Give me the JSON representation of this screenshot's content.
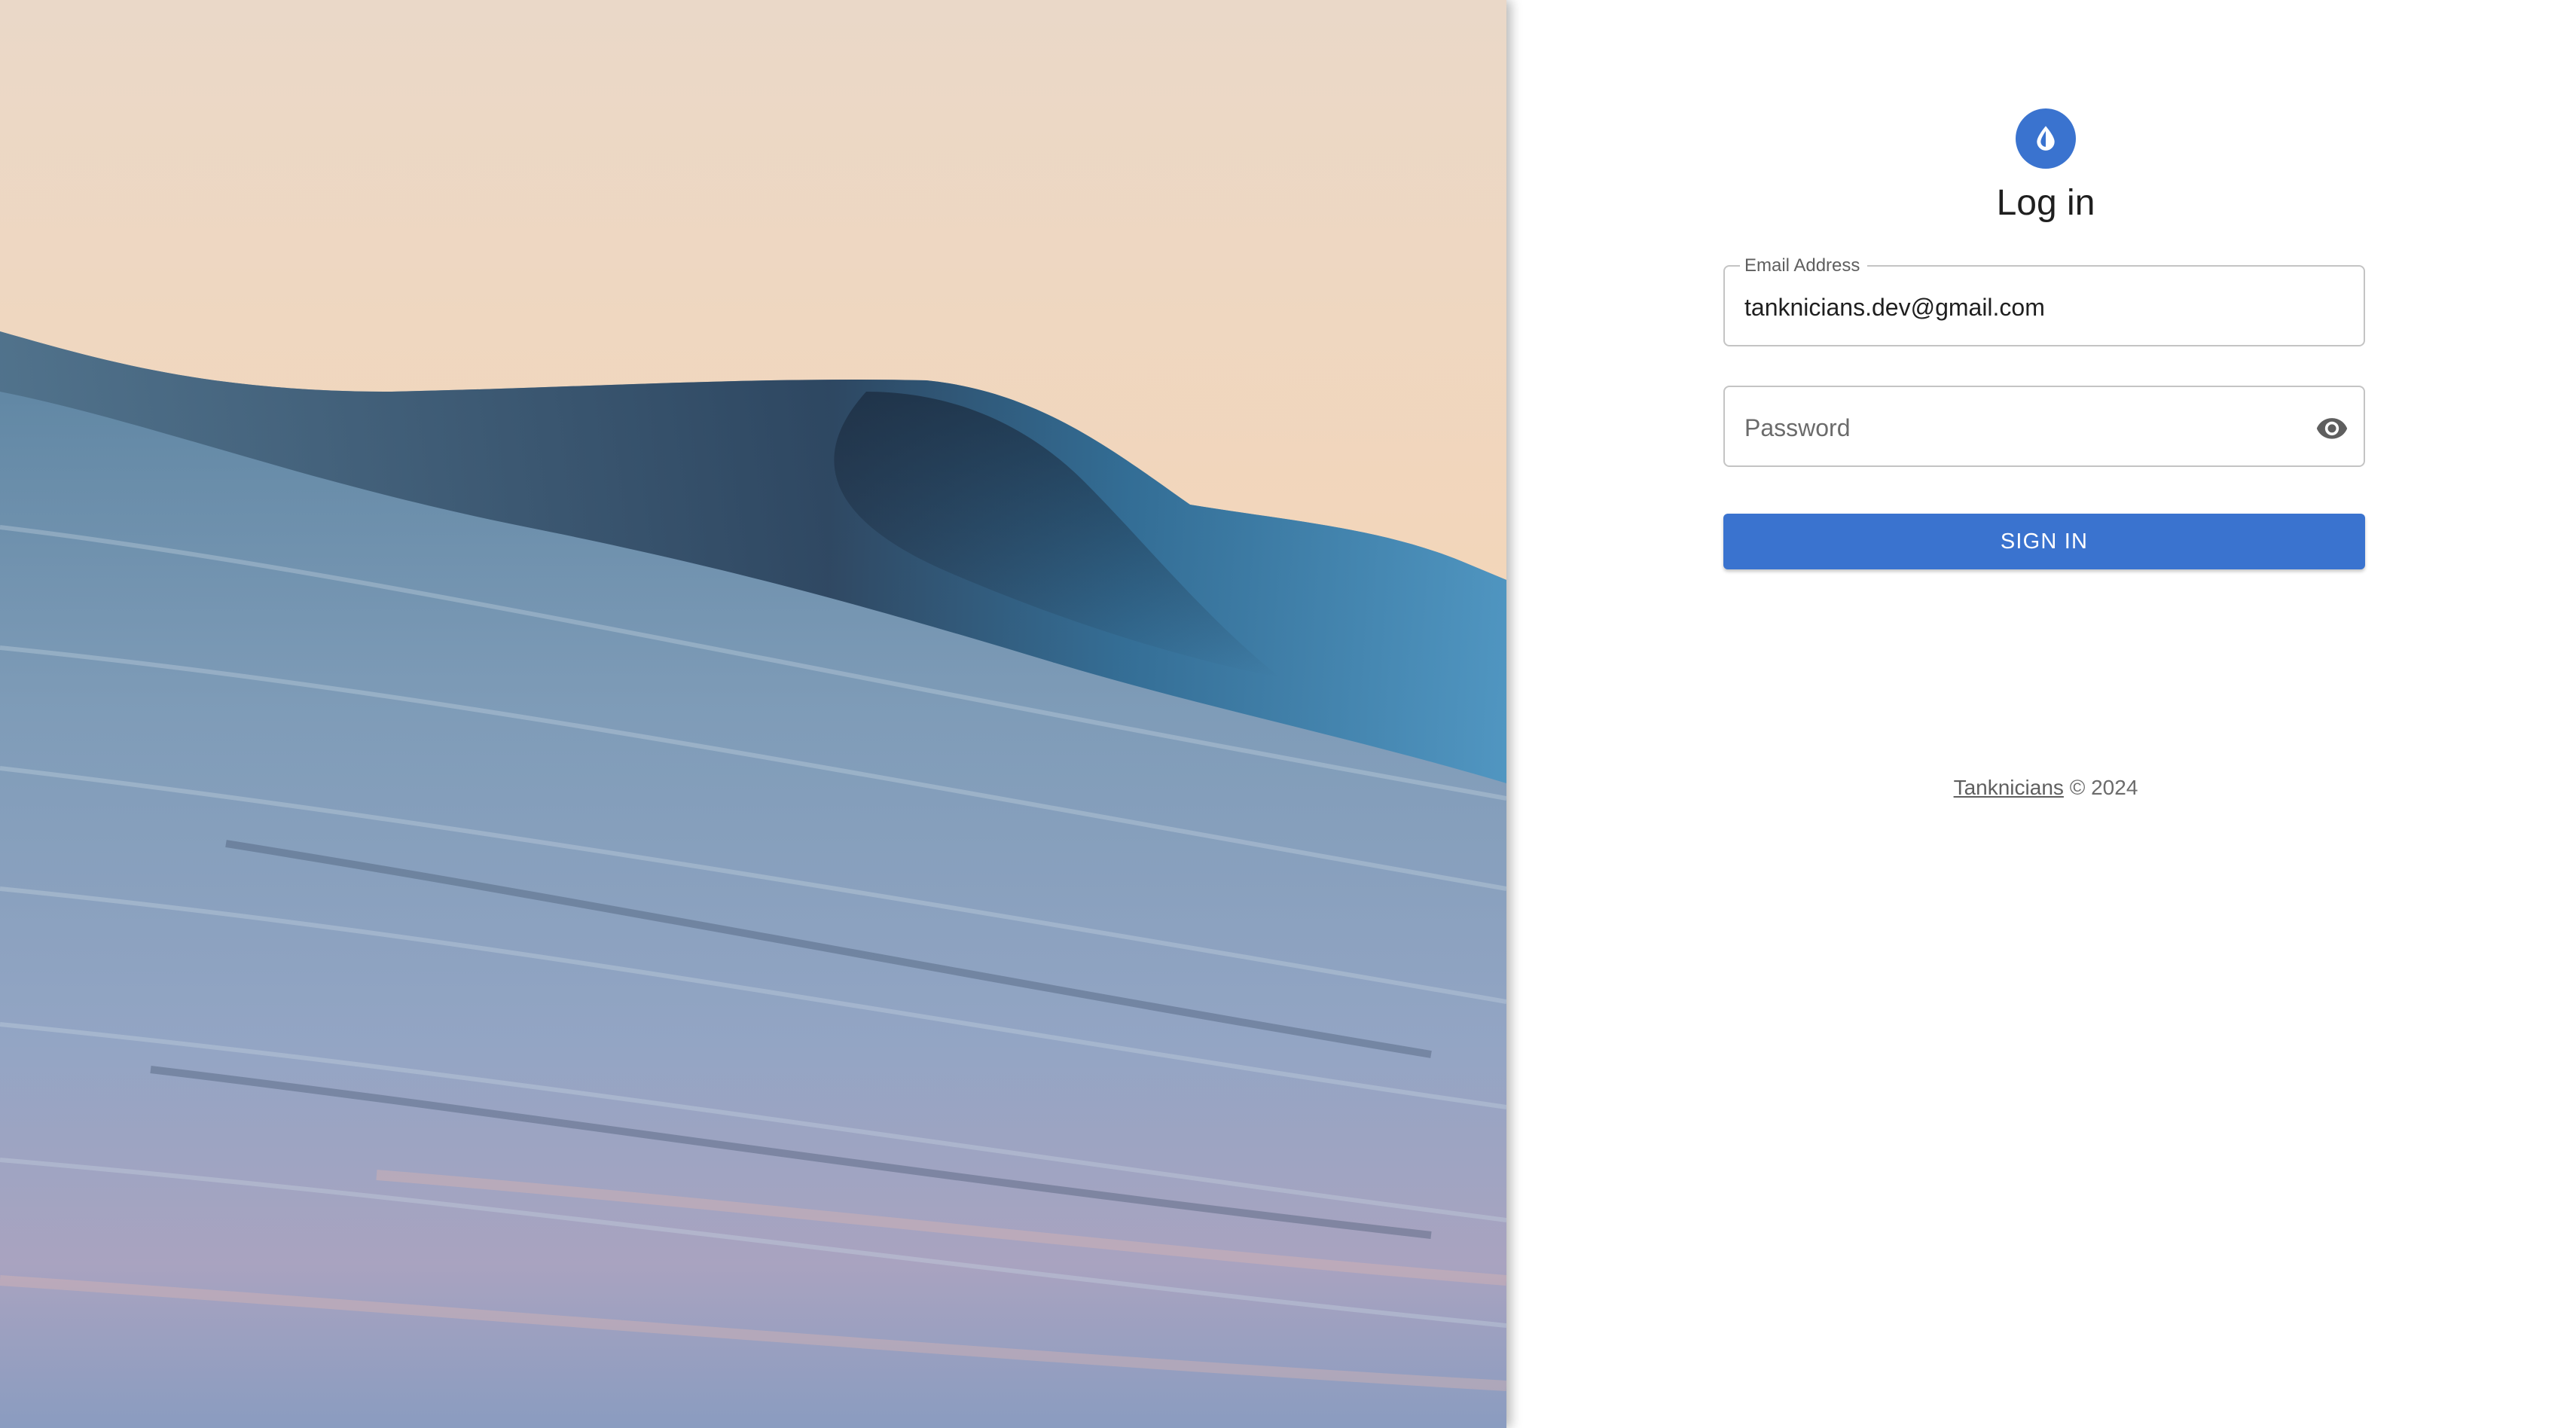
{
  "app": {
    "title": "Log in",
    "logo_icon": "water-drop-icon",
    "accent_color": "#3a73cf"
  },
  "form": {
    "email": {
      "label": "Email Address",
      "value": "tanknicians.dev@gmail.com"
    },
    "password": {
      "placeholder": "Password",
      "toggle_icon": "eye-icon"
    },
    "submit_label": "SIGN IN"
  },
  "footer": {
    "link_text": "Tanknicians",
    "copyright": "© 2024"
  },
  "hero": {
    "image_subject": "ocean wave at sunset"
  }
}
